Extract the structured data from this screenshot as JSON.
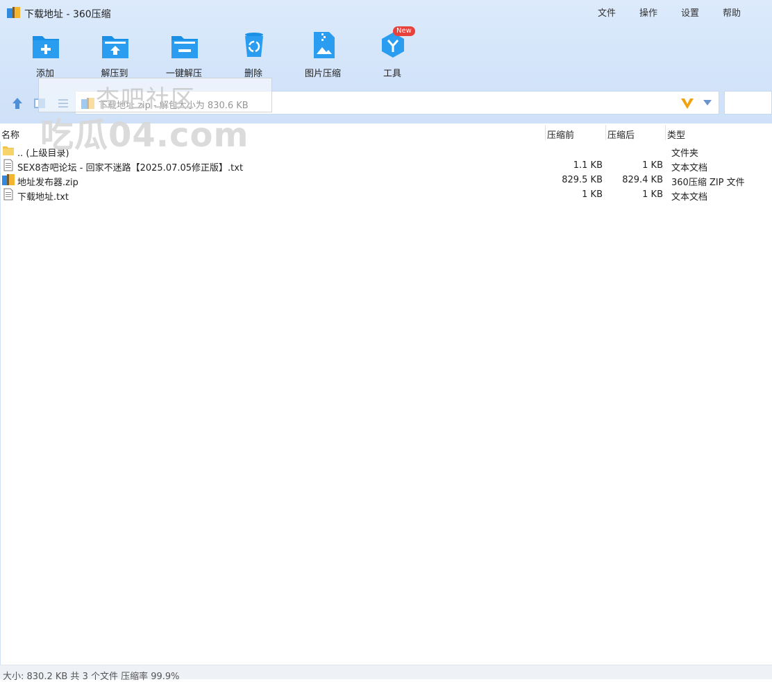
{
  "window": {
    "title": "下载地址 - 360压缩"
  },
  "menu": [
    "文件",
    "操作",
    "设置",
    "帮助"
  ],
  "toolbar": [
    {
      "label": "添加",
      "icon": "add-folder-icon"
    },
    {
      "label": "解压到",
      "icon": "extract-folder-icon"
    },
    {
      "label": "一键解压",
      "icon": "quick-extract-icon"
    },
    {
      "label": "删除",
      "icon": "recycle-bin-icon"
    },
    {
      "label": "图片压缩",
      "icon": "image-compress-icon"
    },
    {
      "label": "工具",
      "icon": "tools-icon",
      "badge": "New"
    }
  ],
  "address": {
    "text": "下载地址.zip - 解包大小为 830.6 KB"
  },
  "columns": {
    "name": "名称",
    "before": "压缩前",
    "after": "压缩后",
    "type": "类型"
  },
  "files": [
    {
      "name": ".. (上级目录)",
      "before": "",
      "after": "",
      "type": "文件夹",
      "icon": "folder-icon"
    },
    {
      "name": "SEX8杏吧论坛 - 回家不迷路【2025.07.05修正版】.txt",
      "before": "1.1 KB",
      "after": "1 KB",
      "type": "文本文档",
      "icon": "text-file-icon"
    },
    {
      "name": "地址发布器.zip",
      "before": "829.5 KB",
      "after": "829.4 KB",
      "type": "360压缩 ZIP 文件",
      "icon": "zip-file-icon"
    },
    {
      "name": "下载地址.txt",
      "before": "1 KB",
      "after": "1 KB",
      "type": "文本文档",
      "icon": "text-file-icon"
    }
  ],
  "status": "大小: 830.2 KB 共 3 个文件 压缩率 99.9%",
  "watermark": {
    "line1": "杏吧社区",
    "line2": "吃瓜04.com"
  },
  "colors": {
    "accent": "#1a8fe6",
    "topbar": "#d6e6fa",
    "badge": "#e8413c",
    "v_logo": "#f2a20c"
  }
}
